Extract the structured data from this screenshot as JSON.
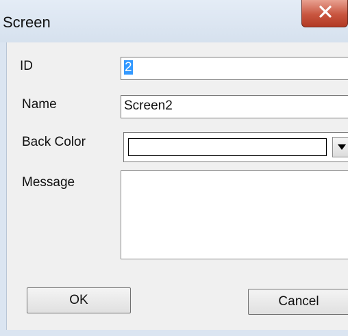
{
  "window": {
    "title": "Screen"
  },
  "form": {
    "id_label": "ID",
    "id_value": "2",
    "name_label": "Name",
    "name_value": "Screen2",
    "back_color_label": "Back Color",
    "back_color_value": "#ffffff",
    "message_label": "Message",
    "message_value": ""
  },
  "buttons": {
    "ok": "OK",
    "cancel": "Cancel"
  },
  "icons": {
    "close": "close-icon",
    "dropdown": "chevron-down-icon"
  },
  "colors": {
    "close_button": "#c8553f",
    "selection": "#3399ff"
  }
}
